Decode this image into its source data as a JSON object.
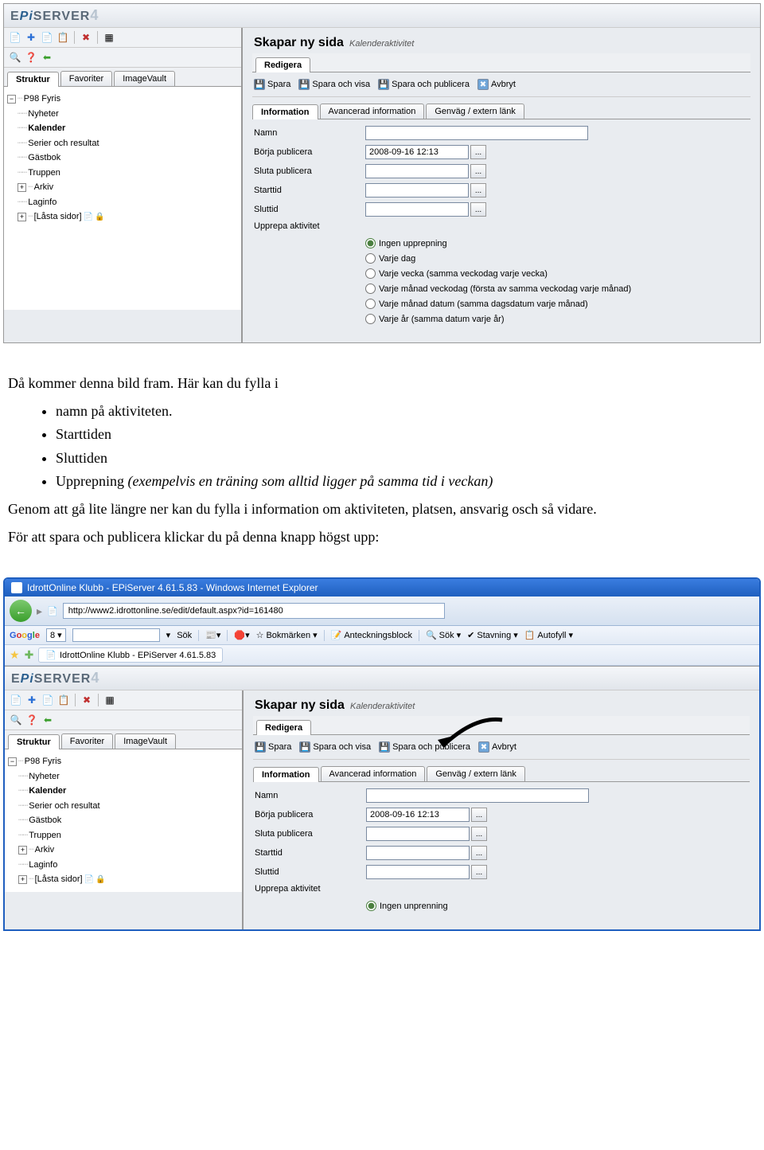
{
  "logo_text": "EPiSERVER",
  "logo_version": "4",
  "sidebar": {
    "tabs": [
      "Struktur",
      "Favoriter",
      "ImageVault"
    ],
    "tree": {
      "root": "P98 Fyris",
      "items": [
        "Nyheter",
        "Kalender",
        "Serier och resultat",
        "Gästbok",
        "Truppen",
        "Arkiv",
        "Laginfo",
        "[Låsta sidor]"
      ]
    }
  },
  "main": {
    "title": "Skapar ny sida",
    "subtitle": "Kalenderaktivitet",
    "edit_tab": "Redigera",
    "actions": {
      "save": "Spara",
      "save_view": "Spara och visa",
      "save_publish": "Spara och publicera",
      "cancel": "Avbryt"
    },
    "inner_tabs": [
      "Information",
      "Avancerad information",
      "Genväg / extern länk"
    ],
    "form": {
      "name_label": "Namn",
      "name_value": "",
      "start_pub_label": "Börja publicera",
      "start_pub_value": "2008-09-16 12:13",
      "end_pub_label": "Sluta publicera",
      "end_pub_value": "",
      "start_time_label": "Starttid",
      "start_time_value": "",
      "end_time_label": "Sluttid",
      "end_time_value": "",
      "repeat_label": "Upprepa aktivitet",
      "repeat_options": [
        "Ingen upprepning",
        "Varje dag",
        "Varje vecka (samma veckodag varje vecka)",
        "Varje månad veckodag (första av samma veckodag varje månad)",
        "Varje månad datum (samma dagsdatum varje månad)",
        "Varje år (samma datum varje år)"
      ],
      "repeat_last_partial": "Ingen unprenning"
    }
  },
  "doc": {
    "p1": "Då kommer denna bild fram. Här kan du fylla i",
    "bullets": [
      "namn på aktiviteten.",
      "Starttiden",
      "Sluttiden",
      "Upprepning (exempelvis en träning som alltid ligger på samma tid i veckan)"
    ],
    "p2": "Genom att gå lite längre ner kan du fylla i information om aktiviteten, platsen, ansvarig osch så vidare.",
    "p3": "För att spara och publicera klickar du på denna knapp högst upp:"
  },
  "ie": {
    "title": "IdrottOnline Klubb - EPiServer 4.61.5.83 - Windows Internet Explorer",
    "url": "http://www2.idrottonline.se/edit/default.aspx?id=161480",
    "tab_title": "IdrottOnline Klubb - EPiServer 4.61.5.83",
    "google": {
      "search_btn": "Sök",
      "bookmarks": "Bokmärken",
      "notes": "Anteckningsblock",
      "find": "Sök",
      "spelling": "Stavning",
      "autofill": "Autofyll"
    }
  }
}
